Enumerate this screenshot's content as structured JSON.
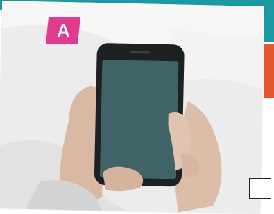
{
  "badge": {
    "label": "A",
    "color": "#e23a8e"
  },
  "answer_box": {
    "checked": false
  },
  "colors": {
    "teal": "#1c9aa3",
    "orange": "#e4562d",
    "phone_screen": "#3f6367"
  }
}
